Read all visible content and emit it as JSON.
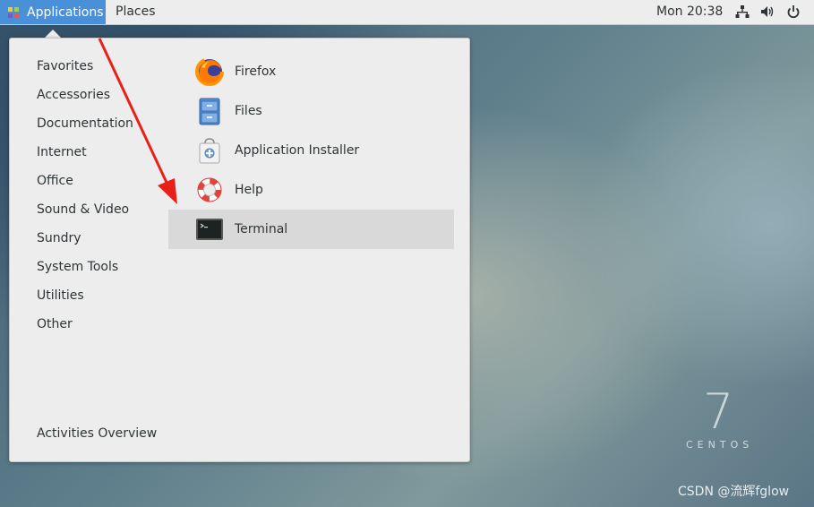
{
  "topbar": {
    "applications_label": "Applications",
    "places_label": "Places",
    "clock": "Mon 20:38"
  },
  "menu": {
    "categories": [
      "Favorites",
      "Accessories",
      "Documentation",
      "Internet",
      "Office",
      "Sound & Video",
      "Sundry",
      "System Tools",
      "Utilities",
      "Other"
    ],
    "activities_overview": "Activities Overview",
    "apps": [
      {
        "label": "Firefox",
        "icon": "firefox-icon"
      },
      {
        "label": "Files",
        "icon": "files-icon"
      },
      {
        "label": "Application Installer",
        "icon": "application-installer-icon"
      },
      {
        "label": "Help",
        "icon": "help-icon"
      },
      {
        "label": "Terminal",
        "icon": "terminal-icon"
      }
    ],
    "highlighted_app": "Terminal"
  },
  "desktop": {
    "logo_number": "7",
    "logo_text": "CENTOS",
    "watermark": "CSDN @流辉fglow"
  },
  "colors": {
    "accent": "#4a90d9",
    "annotation_arrow": "#e8201a"
  }
}
